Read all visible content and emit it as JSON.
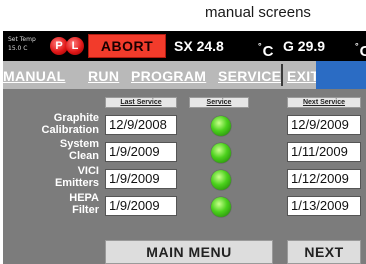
{
  "caption": "manual screens",
  "status_bar": {
    "set_temp_label": "Set Temp",
    "set_temp_value": "15.0  C",
    "lamp_p": "P",
    "lamp_l": "L",
    "abort_label": "ABORT",
    "sx_reading": "SX 24.8",
    "g_reading": "G 29.9",
    "unit_symbol": "°",
    "unit_letter": "C"
  },
  "nav": {
    "items": [
      {
        "label": "MANUAL"
      },
      {
        "label": "RUN"
      },
      {
        "label": "PROGRAM"
      },
      {
        "label": "SERVICE"
      },
      {
        "label": "EXIT"
      }
    ]
  },
  "columns": {
    "last_service": "Last Service",
    "service": "Service",
    "next_service": "Next Service"
  },
  "rows": [
    {
      "label_line1": "Graphite",
      "label_line2": "Calibration",
      "last": "12/9/2008",
      "next": "12/9/2009",
      "status": "ok"
    },
    {
      "label_line1": "System",
      "label_line2": "Clean",
      "last": "1/9/2009",
      "next": "1/11/2009",
      "status": "ok"
    },
    {
      "label_line1": "VICI",
      "label_line2": "Emitters",
      "last": "1/9/2009",
      "next": "1/12/2009",
      "status": "ok"
    },
    {
      "label_line1": "HEPA",
      "label_line2": "Filter",
      "last": "1/9/2009",
      "next": "1/13/2009",
      "status": "ok"
    }
  ],
  "buttons": {
    "main_menu": "MAIN MENU",
    "next": "NEXT"
  },
  "colors": {
    "abort": "#f23b2b",
    "nav_bar": "#b9b9b9",
    "nav_accent": "#2b6cc4",
    "panel": "#7c7c7c",
    "status_led": "#4bd11c"
  }
}
